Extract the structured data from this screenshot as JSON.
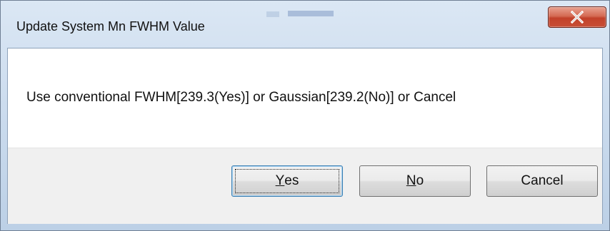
{
  "window": {
    "title": "Update System Mn FWHM Value",
    "close_glyph": "X"
  },
  "message": "Use conventional FWHM[239.3(Yes)] or Gaussian[239.2(No)] or Cancel",
  "buttons": {
    "yes": {
      "mnemonic": "Y",
      "rest": "es"
    },
    "no": {
      "mnemonic": "N",
      "rest": "o"
    },
    "cancel": {
      "label": "Cancel"
    }
  },
  "colors": {
    "close_button": "#c84f36",
    "default_button_border": "#3c7fb1"
  }
}
